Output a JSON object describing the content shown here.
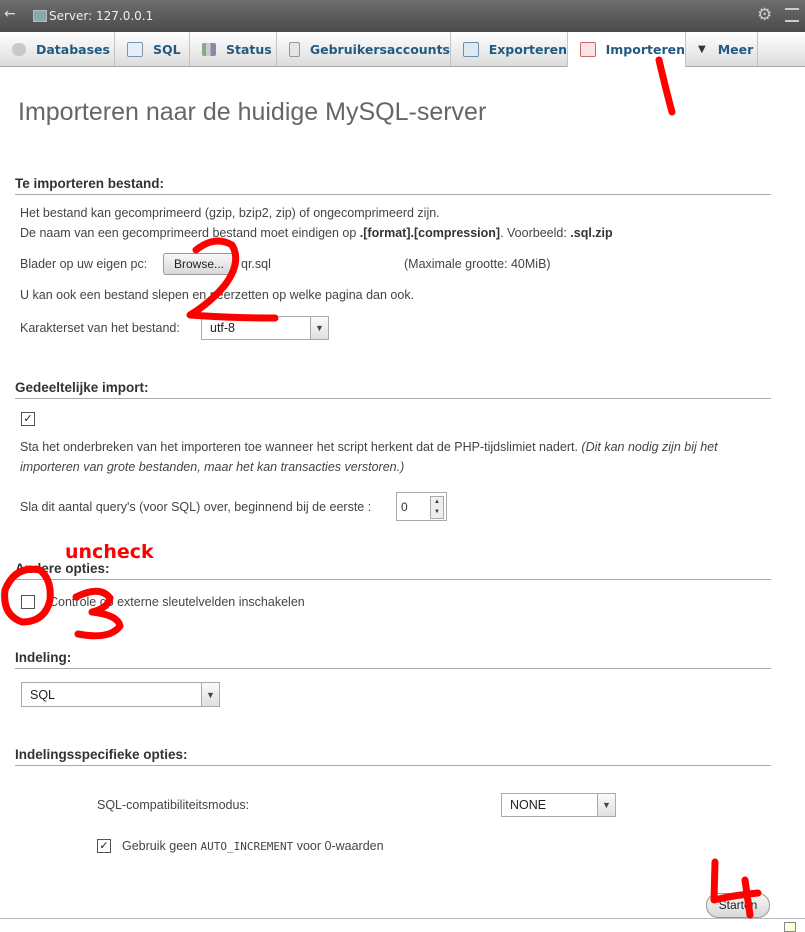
{
  "topbar": {
    "title": "Server: 127.0.0.1"
  },
  "tabs": [
    {
      "label": "Databases",
      "icon": "database-icon"
    },
    {
      "label": "SQL",
      "icon": "sql-icon"
    },
    {
      "label": "Status",
      "icon": "status-icon"
    },
    {
      "label": "Gebruikersaccounts",
      "icon": "users-icon"
    },
    {
      "label": "Exporteren",
      "icon": "export-icon"
    },
    {
      "label": "Importeren",
      "icon": "import-icon"
    },
    {
      "label": "Meer",
      "icon": "chevron-down-icon"
    }
  ],
  "page": {
    "title": "Importeren naar de huidige MySQL-server"
  },
  "file_section": {
    "legend": "Te importeren bestand:",
    "info1": "Het bestand kan gecomprimeerd (gzip, bzip2, zip) of ongecomprimeerd zijn.",
    "info2_prefix": "De naam van een gecomprimeerd bestand moet eindigen op ",
    "info2_bold1": ".[format].[compression]",
    "info2_mid": ". Voorbeeld: ",
    "info2_bold2": ".sql.zip",
    "browse_label": "Blader op uw eigen pc:",
    "browse_button": "Browse...",
    "file_name": "qr.sql",
    "max_size": "(Maximale grootte: 40MiB)",
    "drag_hint": "U kan ook een bestand slepen en neerzetten op welke pagina dan ook.",
    "charset_label": "Karakterset van het bestand:",
    "charset_value": "utf-8"
  },
  "partial_section": {
    "legend": "Gedeeltelijke import:",
    "allow_interrupt_checked": true,
    "desc_normal": "Sta het onderbreken van het importeren toe wanneer het script herkent dat de PHP-tijdslimiet nadert. ",
    "desc_italic1": "(Dit kan nodig zijn bij het",
    "desc_italic2": "importeren van grote bestanden, maar het kan transacties verstoren.)",
    "skip_label": "Sla dit aantal query's (voor SQL) over, beginnend bij de eerste :",
    "skip_value": "0"
  },
  "other_section": {
    "legend": "Andere opties:",
    "fk_checked": false,
    "fk_label": "Controle op externe sleutelvelden inschakelen"
  },
  "format_section": {
    "legend": "Indeling:",
    "format_value": "SQL"
  },
  "format_options_section": {
    "legend": "Indelingsspecifieke opties:",
    "compat_label": "SQL-compatibiliteitsmodus:",
    "compat_value": "NONE",
    "auto_inc_checked": true,
    "auto_inc_prefix": "Gebruik geen ",
    "auto_inc_code": "AUTO_INCREMENT",
    "auto_inc_suffix": " voor 0-waarden"
  },
  "submit_button": "Starten",
  "annotations": {
    "color": "#ff0000",
    "note_uncheck": "uncheck",
    "step1": "1",
    "step2": "2",
    "step3": "3",
    "step4": "4"
  }
}
